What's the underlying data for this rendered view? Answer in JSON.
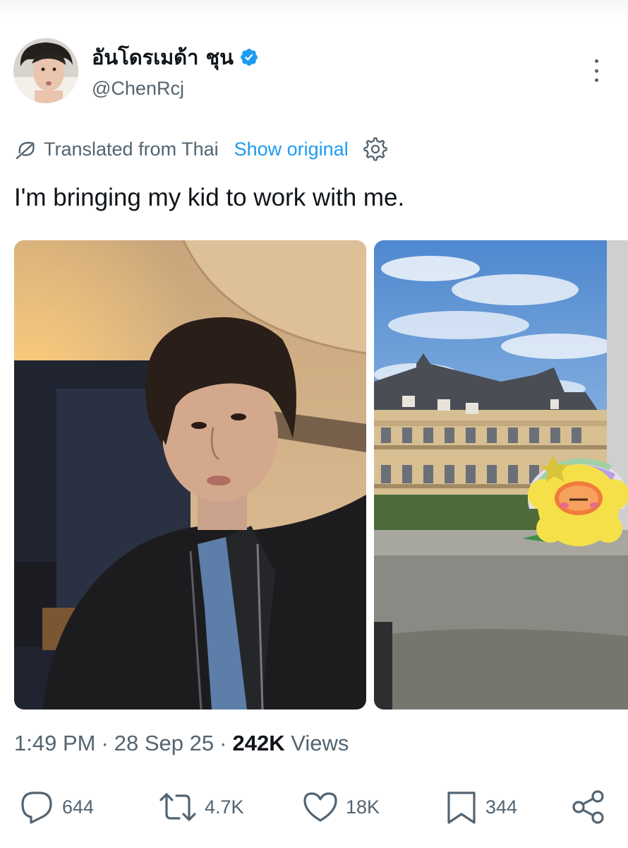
{
  "post": {
    "author": {
      "display_name": "อันโดรเมด้า ชุน",
      "handle": "@ChenRcj",
      "verified": true,
      "verified_color": "#1d9bf0"
    },
    "translation": {
      "label": "Translated from Thai",
      "show_original": "Show original"
    },
    "text": "I'm bringing my kid to work with me.",
    "media": [
      {
        "description_icon": "selfie-photo"
      },
      {
        "description_icon": "building-plush-photo"
      }
    ],
    "meta": {
      "time": "1:49 PM",
      "separator": "·",
      "date": "28 Sep 25",
      "views_count": "242K",
      "views_label": "Views"
    },
    "actions": {
      "replies": "644",
      "reposts": "4.7K",
      "likes": "18K",
      "bookmarks": "344"
    }
  },
  "colors": {
    "accent": "#1d9bf0",
    "secondary_text": "#536471",
    "primary_text": "#0f1419"
  }
}
